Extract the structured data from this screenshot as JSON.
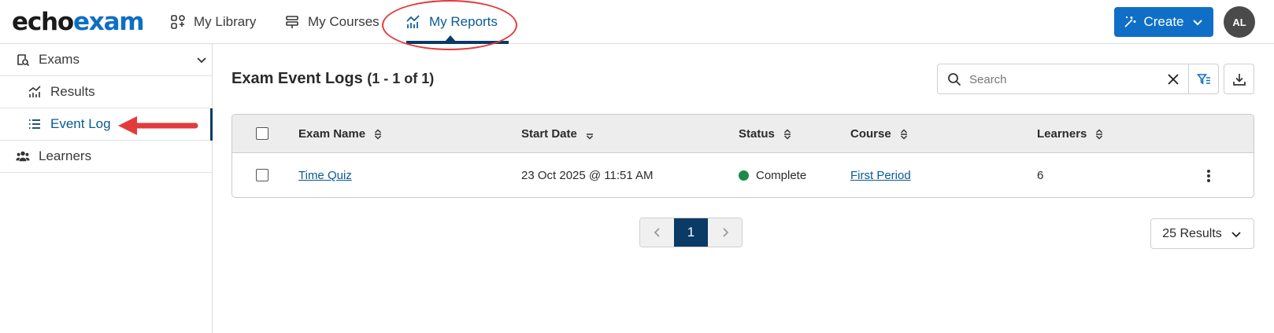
{
  "app": {
    "logo_part1": "echo",
    "logo_part2": "exam"
  },
  "nav": {
    "items": [
      {
        "label": "My Library",
        "icon": "library-icon"
      },
      {
        "label": "My Courses",
        "icon": "courses-icon"
      },
      {
        "label": "My Reports",
        "icon": "reports-chart-icon",
        "active": true
      }
    ],
    "create_label": "Create",
    "avatar_initials": "AL"
  },
  "sidebar": {
    "items": [
      {
        "label": "Exams",
        "icon": "exams-icon",
        "expanded": true
      },
      {
        "label": "Results",
        "icon": "results-chart-icon"
      },
      {
        "label": "Event Log",
        "icon": "list-icon",
        "active": true
      },
      {
        "label": "Learners",
        "icon": "learners-icon"
      }
    ]
  },
  "main": {
    "title": "Exam Event Logs",
    "count_text": "(1 - 1 of 1)",
    "search_placeholder": "Search",
    "table": {
      "columns": [
        "Exam Name",
        "Start Date",
        "Status",
        "Course",
        "Learners"
      ],
      "rows": [
        {
          "exam_name": "Time Quiz",
          "start_date": "23 Oct 2025 @ 11:51 AM",
          "status": "Complete",
          "course": "First Period",
          "learners": "6"
        }
      ]
    },
    "pagination": {
      "current_page": "1"
    },
    "results_per_page": "25 Results"
  },
  "colors": {
    "brand_blue": "#0d6fc4",
    "active_navy": "#0a3a66",
    "status_complete": "#1d8a4a",
    "annotation_red": "#e23b3b"
  }
}
